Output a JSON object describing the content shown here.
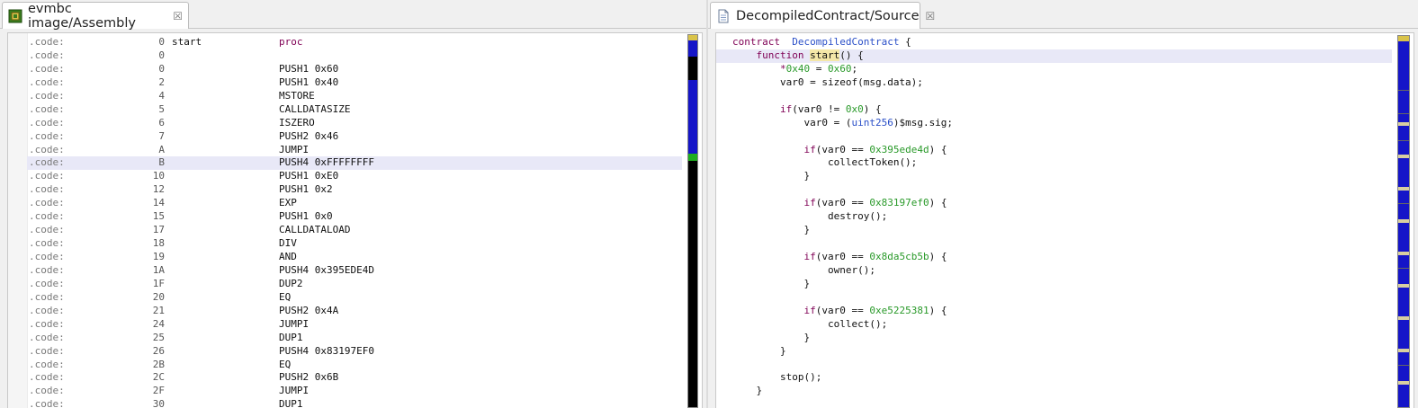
{
  "left_tab": {
    "title": "evmbc image/Assembly",
    "close": "☒"
  },
  "right_tab": {
    "title": "DecompiledContract/Source",
    "close": "☒"
  },
  "assembly": {
    "rows": [
      {
        "seg": ".code:",
        "addr": "0",
        "label": "start",
        "instr": "proc",
        "kw": true
      },
      {
        "seg": ".code:",
        "addr": "0",
        "label": "",
        "instr": ""
      },
      {
        "seg": ".code:",
        "addr": "0",
        "label": "",
        "instr": "PUSH1 0x60"
      },
      {
        "seg": ".code:",
        "addr": "2",
        "label": "",
        "instr": "PUSH1 0x40"
      },
      {
        "seg": ".code:",
        "addr": "4",
        "label": "",
        "instr": "MSTORE"
      },
      {
        "seg": ".code:",
        "addr": "5",
        "label": "",
        "instr": "CALLDATASIZE"
      },
      {
        "seg": ".code:",
        "addr": "6",
        "label": "",
        "instr": "ISZERO"
      },
      {
        "seg": ".code:",
        "addr": "7",
        "label": "",
        "instr": "PUSH2 0x46"
      },
      {
        "seg": ".code:",
        "addr": "A",
        "label": "",
        "instr": "JUMPI"
      },
      {
        "seg": ".code:",
        "addr": "B",
        "label": "",
        "instr": "PUSH4 0xFFFFFFFF",
        "current": true
      },
      {
        "seg": ".code:",
        "addr": "10",
        "label": "",
        "instr": "PUSH1 0xE0"
      },
      {
        "seg": ".code:",
        "addr": "12",
        "label": "",
        "instr": "PUSH1 0x2"
      },
      {
        "seg": ".code:",
        "addr": "14",
        "label": "",
        "instr": "EXP"
      },
      {
        "seg": ".code:",
        "addr": "15",
        "label": "",
        "instr": "PUSH1 0x0"
      },
      {
        "seg": ".code:",
        "addr": "17",
        "label": "",
        "instr": "CALLDATALOAD"
      },
      {
        "seg": ".code:",
        "addr": "18",
        "label": "",
        "instr": "DIV"
      },
      {
        "seg": ".code:",
        "addr": "19",
        "label": "",
        "instr": "AND"
      },
      {
        "seg": ".code:",
        "addr": "1A",
        "label": "",
        "instr": "PUSH4 0x395EDE4D"
      },
      {
        "seg": ".code:",
        "addr": "1F",
        "label": "",
        "instr": "DUP2"
      },
      {
        "seg": ".code:",
        "addr": "20",
        "label": "",
        "instr": "EQ"
      },
      {
        "seg": ".code:",
        "addr": "21",
        "label": "",
        "instr": "PUSH2 0x4A"
      },
      {
        "seg": ".code:",
        "addr": "24",
        "label": "",
        "instr": "JUMPI"
      },
      {
        "seg": ".code:",
        "addr": "25",
        "label": "",
        "instr": "DUP1"
      },
      {
        "seg": ".code:",
        "addr": "26",
        "label": "",
        "instr": "PUSH4 0x83197EF0"
      },
      {
        "seg": ".code:",
        "addr": "2B",
        "label": "",
        "instr": "EQ"
      },
      {
        "seg": ".code:",
        "addr": "2C",
        "label": "",
        "instr": "PUSH2 0x6B"
      },
      {
        "seg": ".code:",
        "addr": "2F",
        "label": "",
        "instr": "JUMPI"
      },
      {
        "seg": ".code:",
        "addr": "30",
        "label": "",
        "instr": "DUP1"
      }
    ]
  },
  "source": {
    "lines": [
      {
        "indent": 0,
        "parts": [
          [
            "kw",
            "contract"
          ],
          [
            "",
            "  "
          ],
          [
            "typ",
            "DecompiledContract"
          ],
          [
            "",
            " {"
          ]
        ]
      },
      {
        "indent": 1,
        "current": true,
        "parts": [
          [
            "kw",
            "function"
          ],
          [
            "",
            " "
          ],
          [
            "caret",
            ""
          ],
          [
            "hl",
            "start"
          ],
          [
            "",
            "() {"
          ]
        ]
      },
      {
        "indent": 2,
        "parts": [
          [
            "kw",
            "*"
          ],
          [
            "num",
            "0x40"
          ],
          [
            "",
            " = "
          ],
          [
            "num",
            "0x60"
          ],
          [
            "",
            ";"
          ]
        ]
      },
      {
        "indent": 2,
        "parts": [
          [
            "",
            "var0 = sizeof(msg.data);"
          ]
        ]
      },
      {
        "indent": 0,
        "parts": []
      },
      {
        "indent": 2,
        "parts": [
          [
            "kw",
            "if"
          ],
          [
            "",
            "(var0 != "
          ],
          [
            "num",
            "0x0"
          ],
          [
            "",
            ") {"
          ]
        ]
      },
      {
        "indent": 3,
        "parts": [
          [
            "",
            "var0 = ("
          ],
          [
            "typ",
            "uint256"
          ],
          [
            "",
            ")$msg.sig;"
          ]
        ]
      },
      {
        "indent": 0,
        "parts": []
      },
      {
        "indent": 3,
        "parts": [
          [
            "kw",
            "if"
          ],
          [
            "",
            "(var0 == "
          ],
          [
            "num",
            "0x395ede4d"
          ],
          [
            "",
            ") {"
          ]
        ]
      },
      {
        "indent": 4,
        "parts": [
          [
            "",
            "collectToken();"
          ]
        ]
      },
      {
        "indent": 3,
        "parts": [
          [
            "",
            "}"
          ]
        ]
      },
      {
        "indent": 0,
        "parts": []
      },
      {
        "indent": 3,
        "parts": [
          [
            "kw",
            "if"
          ],
          [
            "",
            "(var0 == "
          ],
          [
            "num",
            "0x83197ef0"
          ],
          [
            "",
            ") {"
          ]
        ]
      },
      {
        "indent": 4,
        "parts": [
          [
            "",
            "destroy();"
          ]
        ]
      },
      {
        "indent": 3,
        "parts": [
          [
            "",
            "}"
          ]
        ]
      },
      {
        "indent": 0,
        "parts": []
      },
      {
        "indent": 3,
        "parts": [
          [
            "kw",
            "if"
          ],
          [
            "",
            "(var0 == "
          ],
          [
            "num",
            "0x8da5cb5b"
          ],
          [
            "",
            ") {"
          ]
        ]
      },
      {
        "indent": 4,
        "parts": [
          [
            "",
            "owner();"
          ]
        ]
      },
      {
        "indent": 3,
        "parts": [
          [
            "",
            "}"
          ]
        ]
      },
      {
        "indent": 0,
        "parts": []
      },
      {
        "indent": 3,
        "parts": [
          [
            "kw",
            "if"
          ],
          [
            "",
            "(var0 == "
          ],
          [
            "num",
            "0xe5225381"
          ],
          [
            "",
            ") {"
          ]
        ]
      },
      {
        "indent": 4,
        "parts": [
          [
            "",
            "collect();"
          ]
        ]
      },
      {
        "indent": 3,
        "parts": [
          [
            "",
            "}"
          ]
        ]
      },
      {
        "indent": 2,
        "parts": [
          [
            "",
            "}"
          ]
        ]
      },
      {
        "indent": 0,
        "parts": []
      },
      {
        "indent": 2,
        "parts": [
          [
            "",
            "stop();"
          ]
        ]
      },
      {
        "indent": 1,
        "parts": [
          [
            "",
            "}"
          ]
        ]
      }
    ]
  },
  "colors": {
    "keyword": "#7f0055",
    "number": "#2a9a2a",
    "type": "#2a4fc8",
    "current_line": "#e8e8f7",
    "overview_blue": "#1515c8"
  },
  "icons": {
    "left_tab": "chip-icon",
    "right_tab": "document-icon"
  }
}
